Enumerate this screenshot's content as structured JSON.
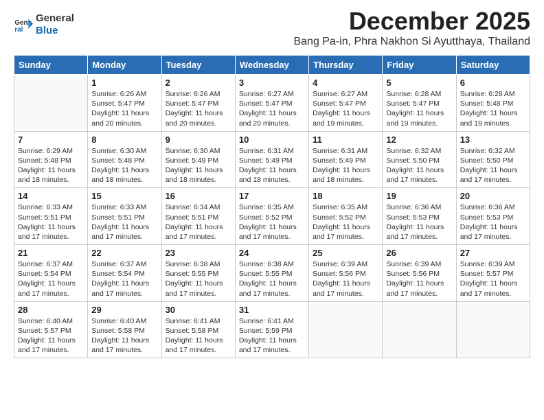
{
  "header": {
    "logo_general": "General",
    "logo_blue": "Blue",
    "month": "December 2025",
    "location": "Bang Pa-in, Phra Nakhon Si Ayutthaya, Thailand"
  },
  "weekdays": [
    "Sunday",
    "Monday",
    "Tuesday",
    "Wednesday",
    "Thursday",
    "Friday",
    "Saturday"
  ],
  "weeks": [
    [
      {
        "day": "",
        "sunrise": "",
        "sunset": "",
        "daylight": ""
      },
      {
        "day": "1",
        "sunrise": "Sunrise: 6:26 AM",
        "sunset": "Sunset: 5:47 PM",
        "daylight": "Daylight: 11 hours and 20 minutes."
      },
      {
        "day": "2",
        "sunrise": "Sunrise: 6:26 AM",
        "sunset": "Sunset: 5:47 PM",
        "daylight": "Daylight: 11 hours and 20 minutes."
      },
      {
        "day": "3",
        "sunrise": "Sunrise: 6:27 AM",
        "sunset": "Sunset: 5:47 PM",
        "daylight": "Daylight: 11 hours and 20 minutes."
      },
      {
        "day": "4",
        "sunrise": "Sunrise: 6:27 AM",
        "sunset": "Sunset: 5:47 PM",
        "daylight": "Daylight: 11 hours and 19 minutes."
      },
      {
        "day": "5",
        "sunrise": "Sunrise: 6:28 AM",
        "sunset": "Sunset: 5:47 PM",
        "daylight": "Daylight: 11 hours and 19 minutes."
      },
      {
        "day": "6",
        "sunrise": "Sunrise: 6:28 AM",
        "sunset": "Sunset: 5:48 PM",
        "daylight": "Daylight: 11 hours and 19 minutes."
      }
    ],
    [
      {
        "day": "7",
        "sunrise": "Sunrise: 6:29 AM",
        "sunset": "Sunset: 5:48 PM",
        "daylight": "Daylight: 11 hours and 18 minutes."
      },
      {
        "day": "8",
        "sunrise": "Sunrise: 6:30 AM",
        "sunset": "Sunset: 5:48 PM",
        "daylight": "Daylight: 11 hours and 18 minutes."
      },
      {
        "day": "9",
        "sunrise": "Sunrise: 6:30 AM",
        "sunset": "Sunset: 5:49 PM",
        "daylight": "Daylight: 11 hours and 18 minutes."
      },
      {
        "day": "10",
        "sunrise": "Sunrise: 6:31 AM",
        "sunset": "Sunset: 5:49 PM",
        "daylight": "Daylight: 11 hours and 18 minutes."
      },
      {
        "day": "11",
        "sunrise": "Sunrise: 6:31 AM",
        "sunset": "Sunset: 5:49 PM",
        "daylight": "Daylight: 11 hours and 18 minutes."
      },
      {
        "day": "12",
        "sunrise": "Sunrise: 6:32 AM",
        "sunset": "Sunset: 5:50 PM",
        "daylight": "Daylight: 11 hours and 17 minutes."
      },
      {
        "day": "13",
        "sunrise": "Sunrise: 6:32 AM",
        "sunset": "Sunset: 5:50 PM",
        "daylight": "Daylight: 11 hours and 17 minutes."
      }
    ],
    [
      {
        "day": "14",
        "sunrise": "Sunrise: 6:33 AM",
        "sunset": "Sunset: 5:51 PM",
        "daylight": "Daylight: 11 hours and 17 minutes."
      },
      {
        "day": "15",
        "sunrise": "Sunrise: 6:33 AM",
        "sunset": "Sunset: 5:51 PM",
        "daylight": "Daylight: 11 hours and 17 minutes."
      },
      {
        "day": "16",
        "sunrise": "Sunrise: 6:34 AM",
        "sunset": "Sunset: 5:51 PM",
        "daylight": "Daylight: 11 hours and 17 minutes."
      },
      {
        "day": "17",
        "sunrise": "Sunrise: 6:35 AM",
        "sunset": "Sunset: 5:52 PM",
        "daylight": "Daylight: 11 hours and 17 minutes."
      },
      {
        "day": "18",
        "sunrise": "Sunrise: 6:35 AM",
        "sunset": "Sunset: 5:52 PM",
        "daylight": "Daylight: 11 hours and 17 minutes."
      },
      {
        "day": "19",
        "sunrise": "Sunrise: 6:36 AM",
        "sunset": "Sunset: 5:53 PM",
        "daylight": "Daylight: 11 hours and 17 minutes."
      },
      {
        "day": "20",
        "sunrise": "Sunrise: 6:36 AM",
        "sunset": "Sunset: 5:53 PM",
        "daylight": "Daylight: 11 hours and 17 minutes."
      }
    ],
    [
      {
        "day": "21",
        "sunrise": "Sunrise: 6:37 AM",
        "sunset": "Sunset: 5:54 PM",
        "daylight": "Daylight: 11 hours and 17 minutes."
      },
      {
        "day": "22",
        "sunrise": "Sunrise: 6:37 AM",
        "sunset": "Sunset: 5:54 PM",
        "daylight": "Daylight: 11 hours and 17 minutes."
      },
      {
        "day": "23",
        "sunrise": "Sunrise: 6:38 AM",
        "sunset": "Sunset: 5:55 PM",
        "daylight": "Daylight: 11 hours and 17 minutes."
      },
      {
        "day": "24",
        "sunrise": "Sunrise: 6:38 AM",
        "sunset": "Sunset: 5:55 PM",
        "daylight": "Daylight: 11 hours and 17 minutes."
      },
      {
        "day": "25",
        "sunrise": "Sunrise: 6:39 AM",
        "sunset": "Sunset: 5:56 PM",
        "daylight": "Daylight: 11 hours and 17 minutes."
      },
      {
        "day": "26",
        "sunrise": "Sunrise: 6:39 AM",
        "sunset": "Sunset: 5:56 PM",
        "daylight": "Daylight: 11 hours and 17 minutes."
      },
      {
        "day": "27",
        "sunrise": "Sunrise: 6:39 AM",
        "sunset": "Sunset: 5:57 PM",
        "daylight": "Daylight: 11 hours and 17 minutes."
      }
    ],
    [
      {
        "day": "28",
        "sunrise": "Sunrise: 6:40 AM",
        "sunset": "Sunset: 5:57 PM",
        "daylight": "Daylight: 11 hours and 17 minutes."
      },
      {
        "day": "29",
        "sunrise": "Sunrise: 6:40 AM",
        "sunset": "Sunset: 5:58 PM",
        "daylight": "Daylight: 11 hours and 17 minutes."
      },
      {
        "day": "30",
        "sunrise": "Sunrise: 6:41 AM",
        "sunset": "Sunset: 5:58 PM",
        "daylight": "Daylight: 11 hours and 17 minutes."
      },
      {
        "day": "31",
        "sunrise": "Sunrise: 6:41 AM",
        "sunset": "Sunset: 5:59 PM",
        "daylight": "Daylight: 11 hours and 17 minutes."
      },
      {
        "day": "",
        "sunrise": "",
        "sunset": "",
        "daylight": ""
      },
      {
        "day": "",
        "sunrise": "",
        "sunset": "",
        "daylight": ""
      },
      {
        "day": "",
        "sunrise": "",
        "sunset": "",
        "daylight": ""
      }
    ]
  ]
}
